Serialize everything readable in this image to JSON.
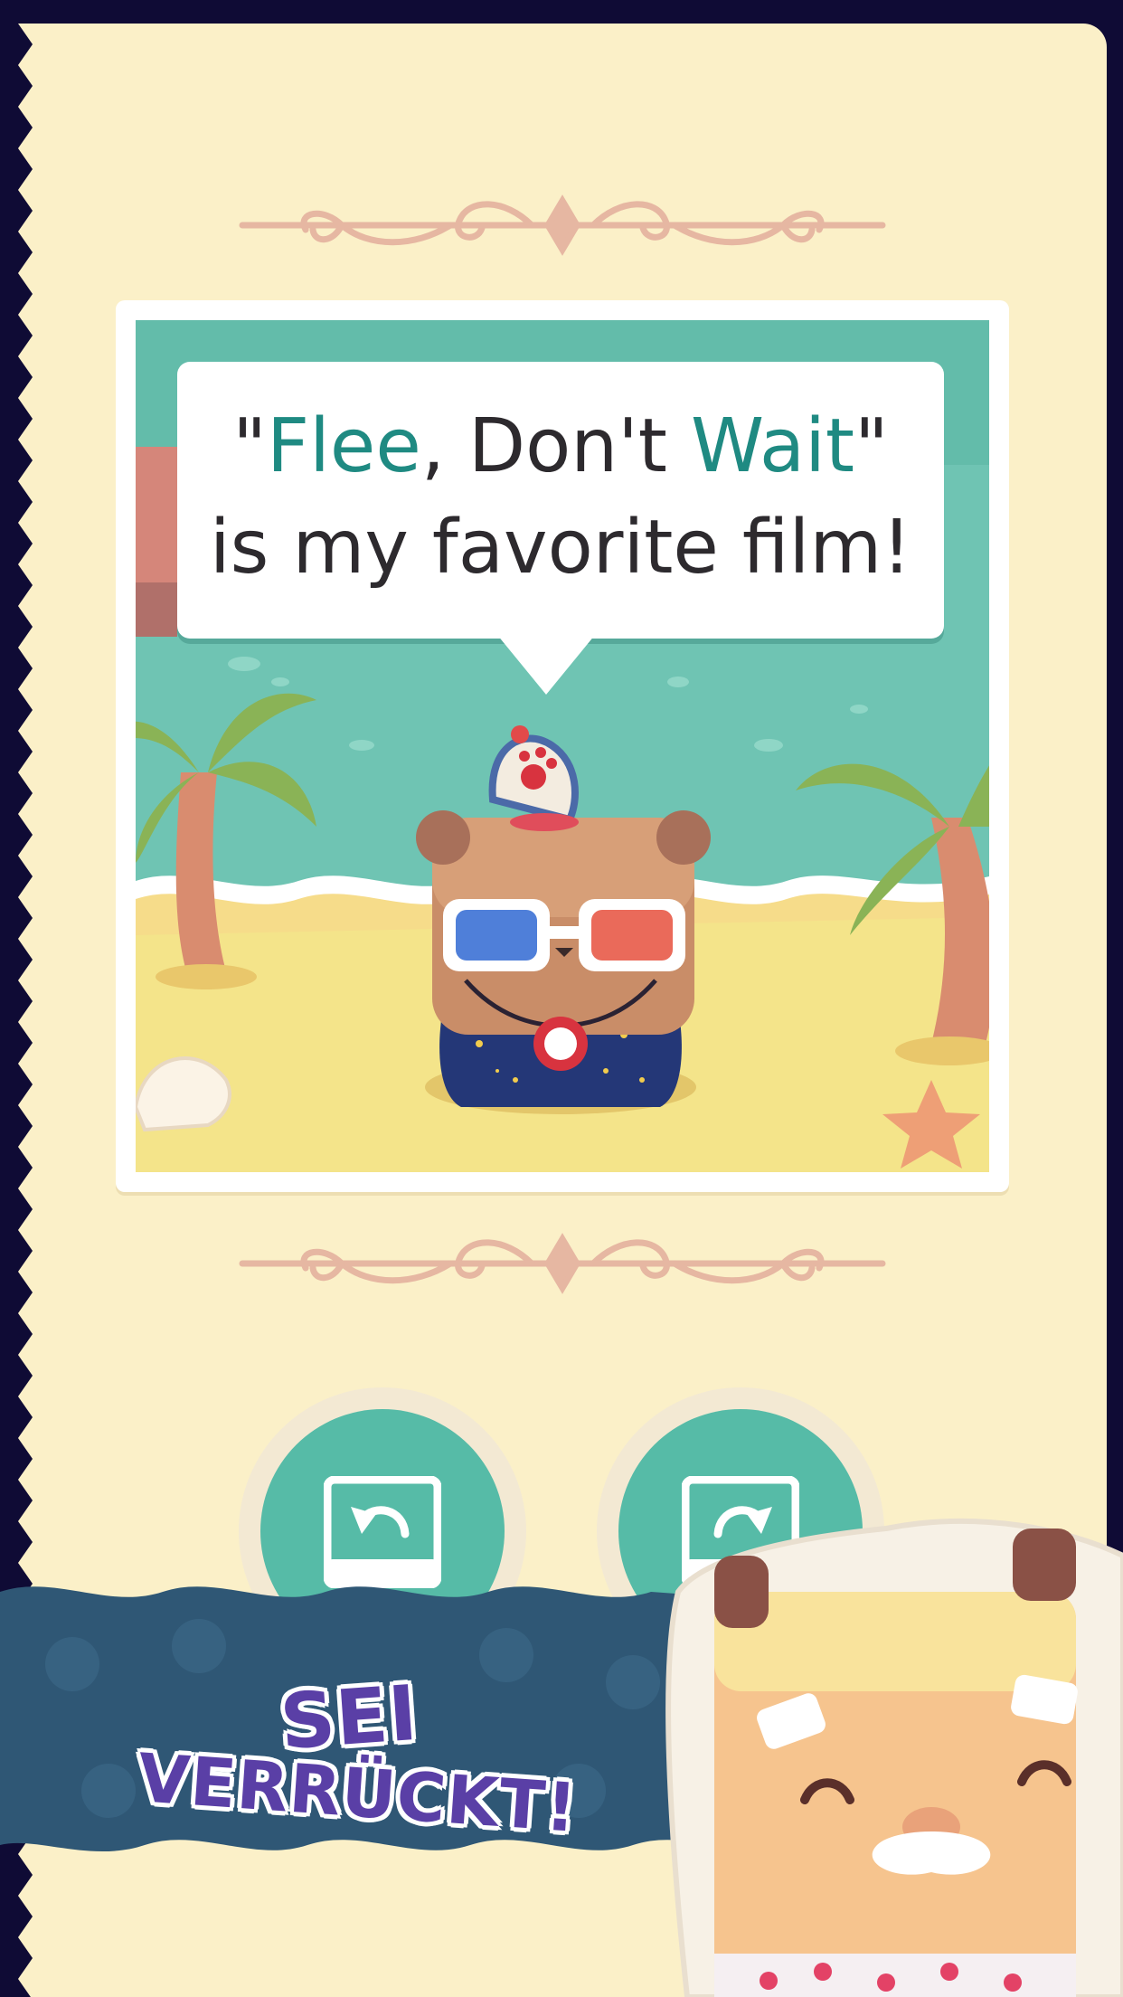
{
  "app": {
    "accent_color": "#1f8a82",
    "page_color": "#fbf0c8",
    "border_color": "#0f0b35"
  },
  "photo": {
    "quote_open": "\"",
    "quote_word1": "Flee",
    "quote_mid": ", Don't ",
    "quote_word2": "Wait",
    "quote_close": "\"",
    "quote_line2": "is my favorite film!",
    "character": "bear-with-3d-glasses",
    "setting": "beach"
  },
  "controls": {
    "rotate_left_icon": "rotate-left-icon",
    "rotate_right_icon": "rotate-right-icon"
  },
  "promo": {
    "line1": "SEI",
    "line2": "VERRÜCKT!",
    "banner_color": "#2f5775",
    "text_color": "#5a3fa6"
  }
}
